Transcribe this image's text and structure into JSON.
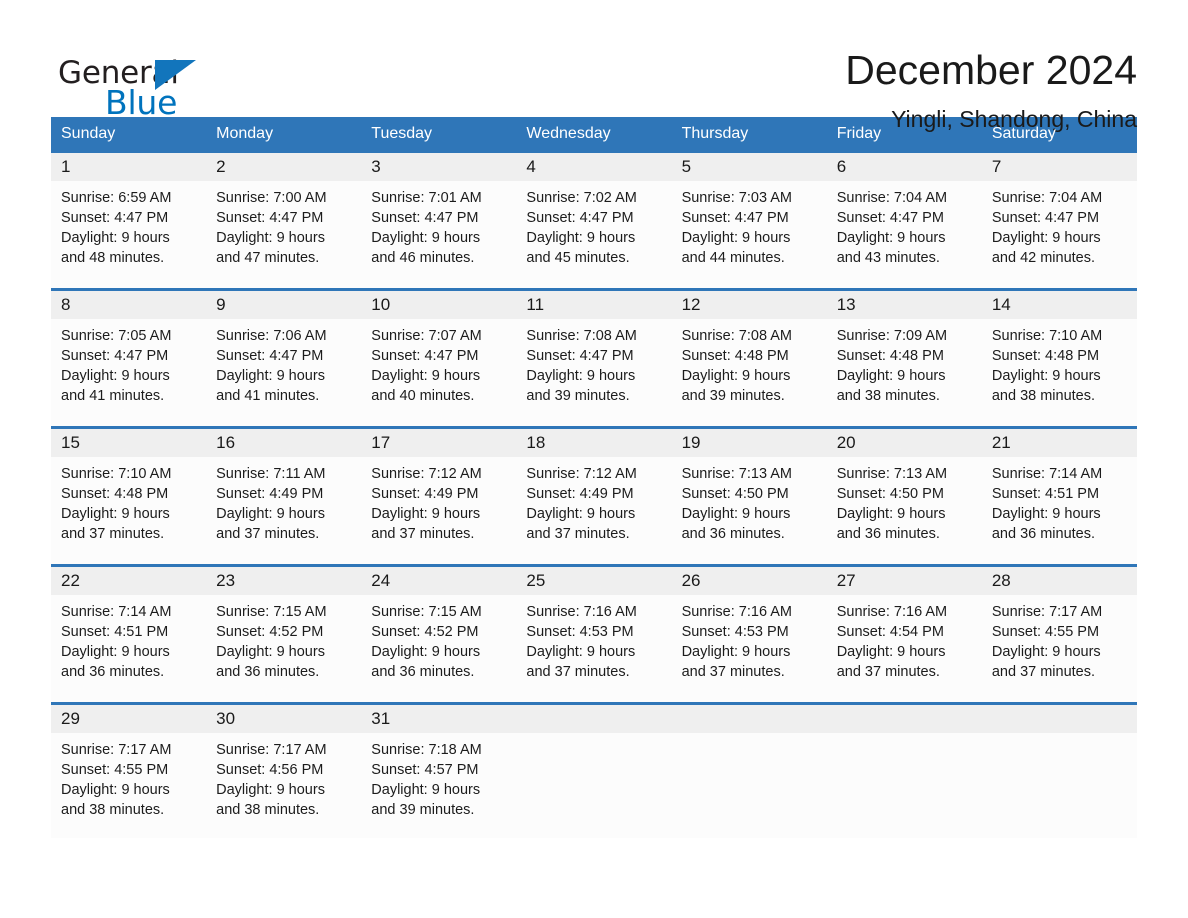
{
  "brand": {
    "name_part1": "General",
    "name_part2": "Blue",
    "triangle_color": "#1275bc",
    "blue_color": "#0073bd"
  },
  "header": {
    "month_title": "December 2024",
    "location": "Yingli, Shandong, China"
  },
  "theme": {
    "header_row_color": "#2f76b8",
    "week_divider_color": "#2f76b8",
    "daynum_band_color": "#efefef",
    "cell_background": "#fcfcfc"
  },
  "weekdays": [
    "Sunday",
    "Monday",
    "Tuesday",
    "Wednesday",
    "Thursday",
    "Friday",
    "Saturday"
  ],
  "weeks": [
    [
      {
        "day": "1",
        "sunrise": "Sunrise: 6:59 AM",
        "sunset": "Sunset: 4:47 PM",
        "daylight1": "Daylight: 9 hours",
        "daylight2": "and 48 minutes."
      },
      {
        "day": "2",
        "sunrise": "Sunrise: 7:00 AM",
        "sunset": "Sunset: 4:47 PM",
        "daylight1": "Daylight: 9 hours",
        "daylight2": "and 47 minutes."
      },
      {
        "day": "3",
        "sunrise": "Sunrise: 7:01 AM",
        "sunset": "Sunset: 4:47 PM",
        "daylight1": "Daylight: 9 hours",
        "daylight2": "and 46 minutes."
      },
      {
        "day": "4",
        "sunrise": "Sunrise: 7:02 AM",
        "sunset": "Sunset: 4:47 PM",
        "daylight1": "Daylight: 9 hours",
        "daylight2": "and 45 minutes."
      },
      {
        "day": "5",
        "sunrise": "Sunrise: 7:03 AM",
        "sunset": "Sunset: 4:47 PM",
        "daylight1": "Daylight: 9 hours",
        "daylight2": "and 44 minutes."
      },
      {
        "day": "6",
        "sunrise": "Sunrise: 7:04 AM",
        "sunset": "Sunset: 4:47 PM",
        "daylight1": "Daylight: 9 hours",
        "daylight2": "and 43 minutes."
      },
      {
        "day": "7",
        "sunrise": "Sunrise: 7:04 AM",
        "sunset": "Sunset: 4:47 PM",
        "daylight1": "Daylight: 9 hours",
        "daylight2": "and 42 minutes."
      }
    ],
    [
      {
        "day": "8",
        "sunrise": "Sunrise: 7:05 AM",
        "sunset": "Sunset: 4:47 PM",
        "daylight1": "Daylight: 9 hours",
        "daylight2": "and 41 minutes."
      },
      {
        "day": "9",
        "sunrise": "Sunrise: 7:06 AM",
        "sunset": "Sunset: 4:47 PM",
        "daylight1": "Daylight: 9 hours",
        "daylight2": "and 41 minutes."
      },
      {
        "day": "10",
        "sunrise": "Sunrise: 7:07 AM",
        "sunset": "Sunset: 4:47 PM",
        "daylight1": "Daylight: 9 hours",
        "daylight2": "and 40 minutes."
      },
      {
        "day": "11",
        "sunrise": "Sunrise: 7:08 AM",
        "sunset": "Sunset: 4:47 PM",
        "daylight1": "Daylight: 9 hours",
        "daylight2": "and 39 minutes."
      },
      {
        "day": "12",
        "sunrise": "Sunrise: 7:08 AM",
        "sunset": "Sunset: 4:48 PM",
        "daylight1": "Daylight: 9 hours",
        "daylight2": "and 39 minutes."
      },
      {
        "day": "13",
        "sunrise": "Sunrise: 7:09 AM",
        "sunset": "Sunset: 4:48 PM",
        "daylight1": "Daylight: 9 hours",
        "daylight2": "and 38 minutes."
      },
      {
        "day": "14",
        "sunrise": "Sunrise: 7:10 AM",
        "sunset": "Sunset: 4:48 PM",
        "daylight1": "Daylight: 9 hours",
        "daylight2": "and 38 minutes."
      }
    ],
    [
      {
        "day": "15",
        "sunrise": "Sunrise: 7:10 AM",
        "sunset": "Sunset: 4:48 PM",
        "daylight1": "Daylight: 9 hours",
        "daylight2": "and 37 minutes."
      },
      {
        "day": "16",
        "sunrise": "Sunrise: 7:11 AM",
        "sunset": "Sunset: 4:49 PM",
        "daylight1": "Daylight: 9 hours",
        "daylight2": "and 37 minutes."
      },
      {
        "day": "17",
        "sunrise": "Sunrise: 7:12 AM",
        "sunset": "Sunset: 4:49 PM",
        "daylight1": "Daylight: 9 hours",
        "daylight2": "and 37 minutes."
      },
      {
        "day": "18",
        "sunrise": "Sunrise: 7:12 AM",
        "sunset": "Sunset: 4:49 PM",
        "daylight1": "Daylight: 9 hours",
        "daylight2": "and 37 minutes."
      },
      {
        "day": "19",
        "sunrise": "Sunrise: 7:13 AM",
        "sunset": "Sunset: 4:50 PM",
        "daylight1": "Daylight: 9 hours",
        "daylight2": "and 36 minutes."
      },
      {
        "day": "20",
        "sunrise": "Sunrise: 7:13 AM",
        "sunset": "Sunset: 4:50 PM",
        "daylight1": "Daylight: 9 hours",
        "daylight2": "and 36 minutes."
      },
      {
        "day": "21",
        "sunrise": "Sunrise: 7:14 AM",
        "sunset": "Sunset: 4:51 PM",
        "daylight1": "Daylight: 9 hours",
        "daylight2": "and 36 minutes."
      }
    ],
    [
      {
        "day": "22",
        "sunrise": "Sunrise: 7:14 AM",
        "sunset": "Sunset: 4:51 PM",
        "daylight1": "Daylight: 9 hours",
        "daylight2": "and 36 minutes."
      },
      {
        "day": "23",
        "sunrise": "Sunrise: 7:15 AM",
        "sunset": "Sunset: 4:52 PM",
        "daylight1": "Daylight: 9 hours",
        "daylight2": "and 36 minutes."
      },
      {
        "day": "24",
        "sunrise": "Sunrise: 7:15 AM",
        "sunset": "Sunset: 4:52 PM",
        "daylight1": "Daylight: 9 hours",
        "daylight2": "and 36 minutes."
      },
      {
        "day": "25",
        "sunrise": "Sunrise: 7:16 AM",
        "sunset": "Sunset: 4:53 PM",
        "daylight1": "Daylight: 9 hours",
        "daylight2": "and 37 minutes."
      },
      {
        "day": "26",
        "sunrise": "Sunrise: 7:16 AM",
        "sunset": "Sunset: 4:53 PM",
        "daylight1": "Daylight: 9 hours",
        "daylight2": "and 37 minutes."
      },
      {
        "day": "27",
        "sunrise": "Sunrise: 7:16 AM",
        "sunset": "Sunset: 4:54 PM",
        "daylight1": "Daylight: 9 hours",
        "daylight2": "and 37 minutes."
      },
      {
        "day": "28",
        "sunrise": "Sunrise: 7:17 AM",
        "sunset": "Sunset: 4:55 PM",
        "daylight1": "Daylight: 9 hours",
        "daylight2": "and 37 minutes."
      }
    ],
    [
      {
        "day": "29",
        "sunrise": "Sunrise: 7:17 AM",
        "sunset": "Sunset: 4:55 PM",
        "daylight1": "Daylight: 9 hours",
        "daylight2": "and 38 minutes."
      },
      {
        "day": "30",
        "sunrise": "Sunrise: 7:17 AM",
        "sunset": "Sunset: 4:56 PM",
        "daylight1": "Daylight: 9 hours",
        "daylight2": "and 38 minutes."
      },
      {
        "day": "31",
        "sunrise": "Sunrise: 7:18 AM",
        "sunset": "Sunset: 4:57 PM",
        "daylight1": "Daylight: 9 hours",
        "daylight2": "and 39 minutes."
      },
      {
        "day": "",
        "sunrise": "",
        "sunset": "",
        "daylight1": "",
        "daylight2": ""
      },
      {
        "day": "",
        "sunrise": "",
        "sunset": "",
        "daylight1": "",
        "daylight2": ""
      },
      {
        "day": "",
        "sunrise": "",
        "sunset": "",
        "daylight1": "",
        "daylight2": ""
      },
      {
        "day": "",
        "sunrise": "",
        "sunset": "",
        "daylight1": "",
        "daylight2": ""
      }
    ]
  ]
}
